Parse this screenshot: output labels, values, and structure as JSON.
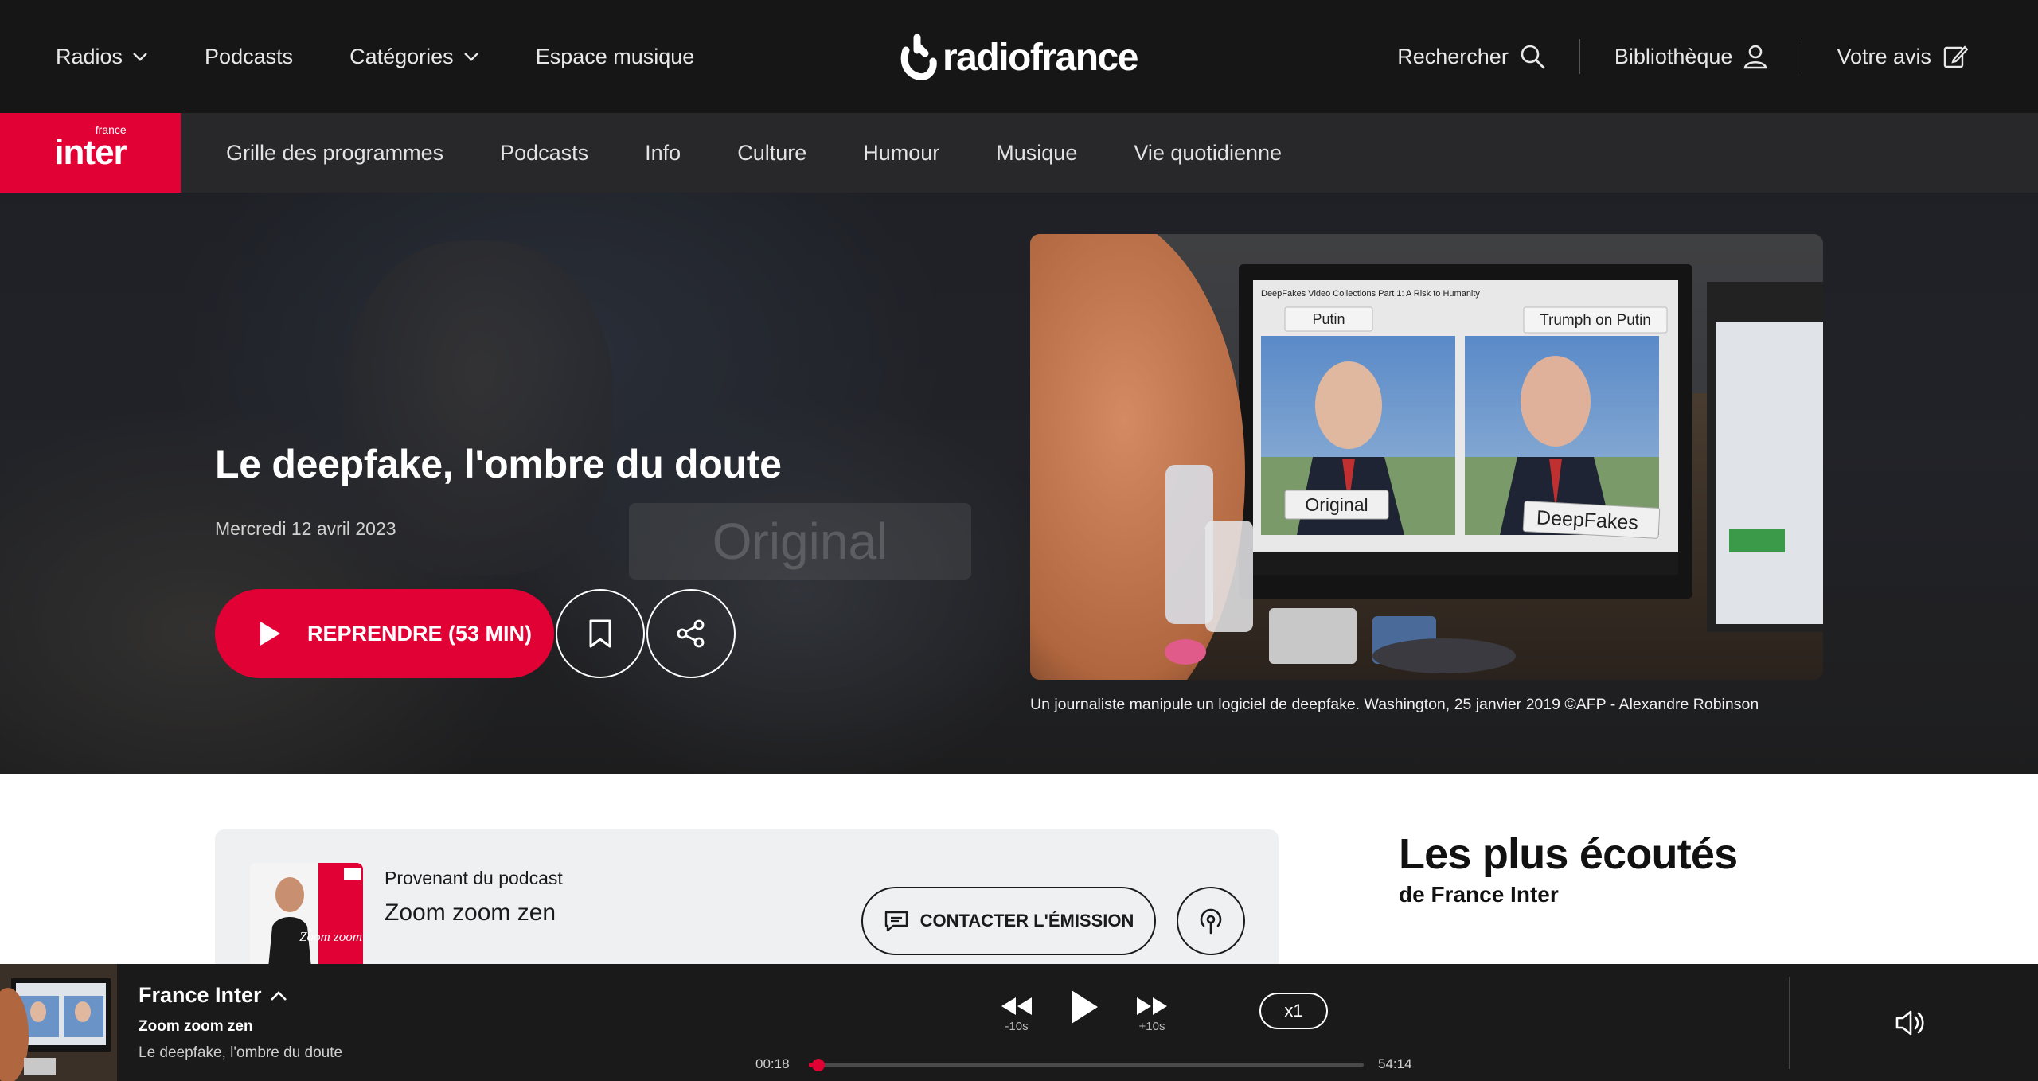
{
  "topnav": {
    "links": [
      {
        "label": "Radios",
        "dropdown": true
      },
      {
        "label": "Podcasts",
        "dropdown": false
      },
      {
        "label": "Catégories",
        "dropdown": true
      },
      {
        "label": "Espace musique",
        "dropdown": false
      }
    ],
    "logo_text": "radiofrance",
    "search_label": "Rechercher",
    "library_label": "Bibliothèque",
    "feedback_label": "Votre avis"
  },
  "subnav": {
    "brand": "inter",
    "brand_small": "france",
    "links": [
      "Grille des programmes",
      "Podcasts",
      "Info",
      "Culture",
      "Humour",
      "Musique",
      "Vie quotidienne"
    ]
  },
  "hero": {
    "title": "Le deepfake, l'ombre du doute",
    "date": "Mercredi 12 avril 2023",
    "resume_label": "REPRENDRE (53 MIN)",
    "caption": "Un journaliste manipule un logiciel de deepfake. Washington, 25 janvier 2019 ©AFP - Alexandre Robinson",
    "image_labels": {
      "left": "Putin",
      "right": "Trumph on Putin",
      "bottom_left": "Original",
      "bottom_right": "DeepFakes",
      "video_title": "DeepFakes Video Collections Part 1: A Risk to Humanity"
    },
    "background_text": "Original"
  },
  "podcast": {
    "from_label": "Provenant du podcast",
    "name": "Zoom zoom zen",
    "contact_label": "CONTACTER L'ÉMISSION"
  },
  "most_listened": {
    "title": "Les plus écoutés",
    "subtitle": "de France Inter"
  },
  "player": {
    "station": "France Inter",
    "show": "Zoom zoom zen",
    "episode": "Le deepfake, l'ombre du doute",
    "rewind_label": "-10s",
    "forward_label": "+10s",
    "speed": "x1",
    "elapsed": "00:18",
    "duration": "54:14",
    "progress_fraction": 0.0055
  },
  "colors": {
    "brand_red": "#e20134",
    "nav_bg": "#161616",
    "player_bg": "#1a1a1a"
  }
}
